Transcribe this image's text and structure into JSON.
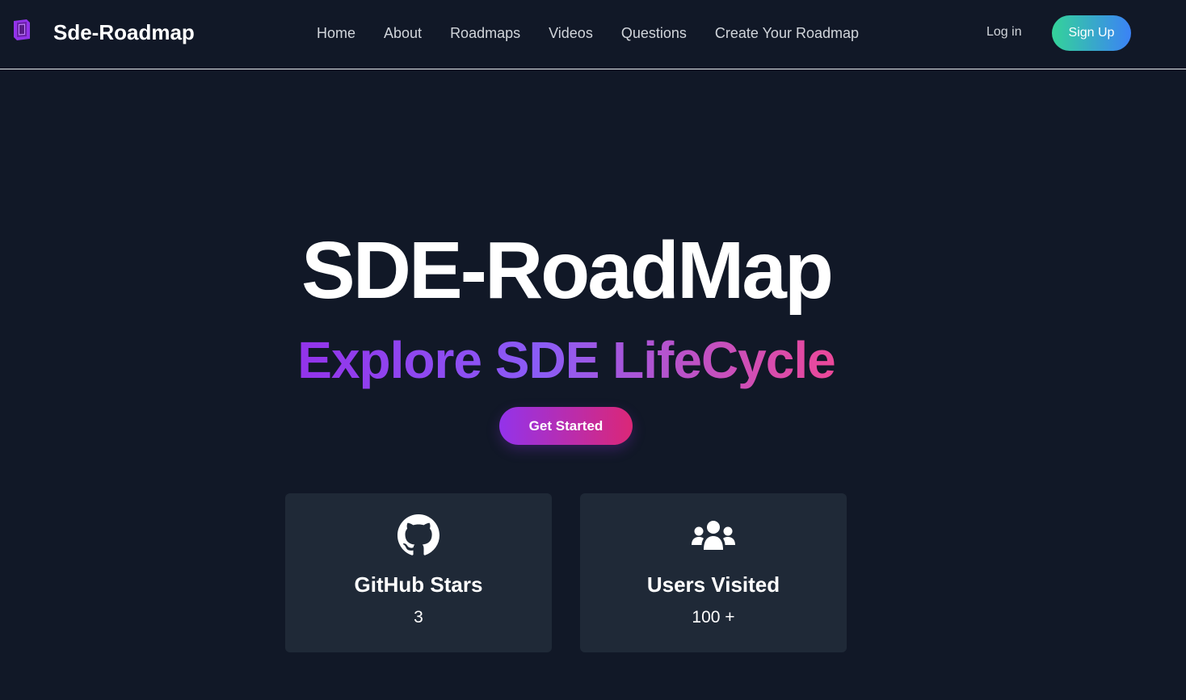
{
  "brand": {
    "name": "Sde-Roadmap",
    "icon": "logo-icon"
  },
  "nav": {
    "links": [
      "Home",
      "About",
      "Roadmaps",
      "Videos",
      "Questions",
      "Create Your Roadmap"
    ],
    "login_label": "Log in",
    "signup_label": "Sign Up"
  },
  "hero": {
    "title": "SDE-RoadMap",
    "subtitle": "Explore SDE LifeCycle",
    "cta_label": "Get Started"
  },
  "stats": [
    {
      "icon": "github-icon",
      "title": "GitHub Stars",
      "value": "3"
    },
    {
      "icon": "users-icon",
      "title": "Users Visited",
      "value": "100 +"
    }
  ],
  "colors": {
    "background": "#111827",
    "card": "#1f2937",
    "accent_purple": "#9333ea",
    "accent_pink": "#db2777",
    "signup_green": "#34d399",
    "signup_blue": "#3b82f6"
  }
}
